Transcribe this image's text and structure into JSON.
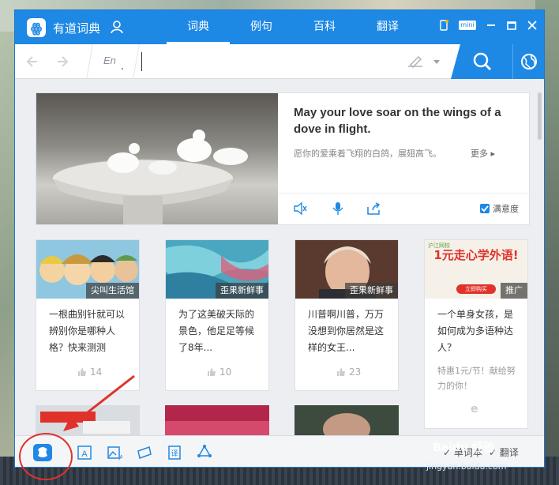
{
  "app": {
    "title": "有道词典"
  },
  "tabs": [
    {
      "label": "词典",
      "active": true
    },
    {
      "label": "例句",
      "active": false
    },
    {
      "label": "百科",
      "active": false
    },
    {
      "label": "翻译",
      "active": false
    }
  ],
  "window_controls": {
    "mini_label": "mini"
  },
  "search": {
    "lang": "En",
    "value": "",
    "placeholder": ""
  },
  "daily": {
    "en": "May your love soar on the wings of a dove in flight.",
    "cn": "愿你的爱乘着飞翔的白鸽，展翅高飞。",
    "more": "更多",
    "satisfaction": "满意度"
  },
  "cards": [
    {
      "tag": "尖叫生活馆",
      "title": "一根曲别针就可以辨别你是哪种人格？快来测测",
      "likes": "14",
      "image": "anime-characters"
    },
    {
      "tag": "歪果新鲜事",
      "title": "为了这美破天际的景色，他足足等候了8年...",
      "likes": "10",
      "image": "blue-abstract"
    },
    {
      "tag": "歪果新鲜事",
      "title": "川普啊川普，万万没想到你居然是这样的女王...",
      "likes": "23",
      "image": "portrait"
    },
    {
      "tag": "推广",
      "title": "一个单身女孩，是如何成为多语种达人？",
      "promo": "特惠1元/节！献给努力的你！",
      "image_text": "1元走心学外语!",
      "image_brand": "沪江网校",
      "image_button": "立即购买",
      "image": "ad"
    }
  ],
  "bottom": {
    "vocab_label": "单词本",
    "close_label": "翻译"
  },
  "watermark": {
    "text": "jingyan.baidu.com",
    "logo": "Baidu 经验"
  },
  "colors": {
    "accent": "#1e88e5",
    "annotation": "#e0322a"
  }
}
